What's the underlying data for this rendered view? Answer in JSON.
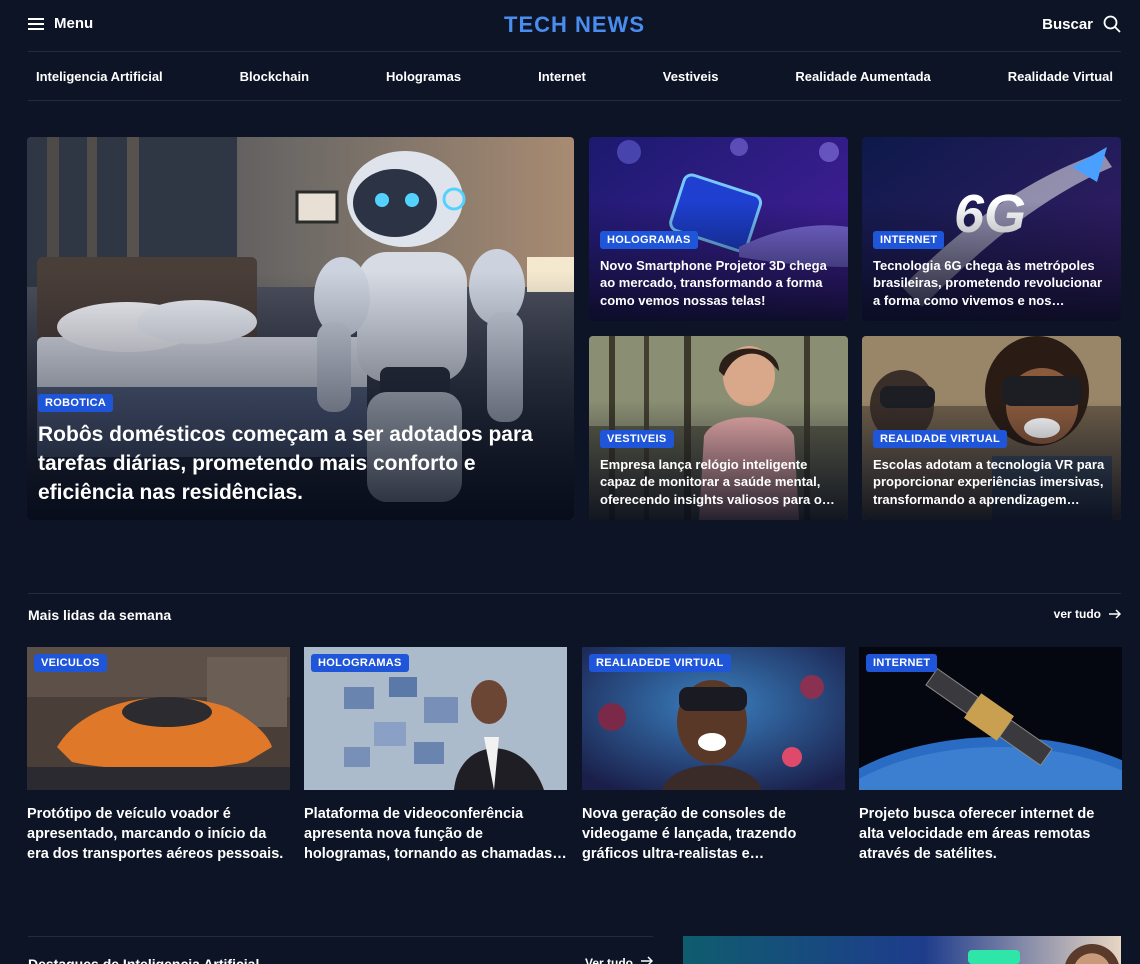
{
  "header": {
    "menu_label": "Menu",
    "logo": "TECH NEWS",
    "search_label": "Buscar"
  },
  "nav": [
    "Inteligencia Artificial",
    "Blockchain",
    "Hologramas",
    "Internet",
    "Vestiveis",
    "Realidade Aumentada",
    "Realidade Virtual"
  ],
  "hero": {
    "main": {
      "badge": "ROBOTICA",
      "title": "Robôs domésticos começam a ser adotados para tarefas diárias, prometendo mais conforto e eficiência nas residências."
    },
    "side": [
      {
        "badge": "HOLOGRAMAS",
        "title": "Novo Smartphone Projetor 3D chega ao mercado, transformando a forma como vemos nossas telas!"
      },
      {
        "badge": "INTERNET",
        "title": "Tecnologia 6G chega às metrópoles brasileiras, prometendo revolucionar a forma como vivemos e nos comunicamos."
      },
      {
        "badge": "VESTIVEIS",
        "title": "Empresa lança relógio inteligente capaz de monitorar a saúde mental, oferecendo insights valiosos para o bem-estar."
      },
      {
        "badge": "REALIDADE VIRTUAL",
        "title": "Escolas adotam a tecnologia VR para proporcionar experiências imersivas, transformando a aprendizagem tradicional."
      }
    ],
    "side_overlay_text": "6G"
  },
  "most_read": {
    "title": "Mais lidas da semana",
    "more_label": "ver tudo",
    "items": [
      {
        "badge": "VEICULOS",
        "title": "Protótipo de veículo voador é apresentado, marcando o início da era dos transportes aéreos pessoais."
      },
      {
        "badge": "HOLOGRAMAS",
        "title": "Plataforma de videoconferência apresenta nova função de hologramas, tornando as chamadas mais reais."
      },
      {
        "badge": "REALIADEDE VIRTUAL",
        "title": "Nova geração de consoles de videogame é lançada, trazendo gráficos ultra-realistas e experiências."
      },
      {
        "badge": "INTERNET",
        "title": "Projeto busca oferecer internet de alta velocidade em áreas remotas através de satélites."
      }
    ]
  },
  "ai_section": {
    "title": "Destaques de Inteligencia Artificial",
    "more_label": "Ver tudo"
  },
  "colors": {
    "background": "#0d1425",
    "accent": "#4a8df0",
    "badge": "#1f56d9",
    "divider": "#232b3d"
  },
  "icons": {
    "menu": "hamburger-icon",
    "search": "search-icon",
    "arrow": "arrow-right-icon"
  }
}
